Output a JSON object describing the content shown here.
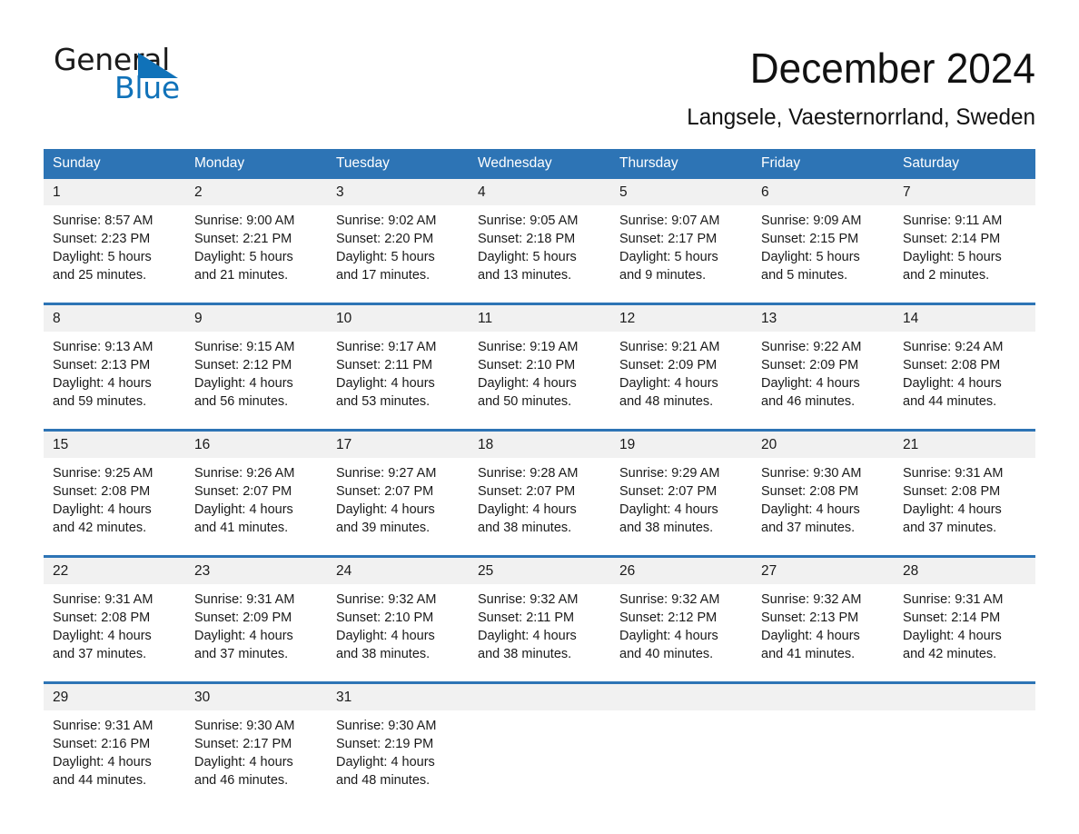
{
  "brand": {
    "name_dark": "General",
    "name_light": "Blue",
    "triangle_color": "#1072b9"
  },
  "header": {
    "month_title": "December 2024",
    "location": "Langsele, Vaesternorrland, Sweden"
  },
  "theme": {
    "header_blue": "#2d74b5",
    "daynum_band": "#f1f1f1",
    "text": "#1a1a1a"
  },
  "calendar": {
    "weekday_headers": [
      "Sunday",
      "Monday",
      "Tuesday",
      "Wednesday",
      "Thursday",
      "Friday",
      "Saturday"
    ],
    "weeks": [
      [
        {
          "day": "1",
          "sunrise": "Sunrise: 8:57 AM",
          "sunset": "Sunset: 2:23 PM",
          "daylight1": "Daylight: 5 hours",
          "daylight2": "and 25 minutes."
        },
        {
          "day": "2",
          "sunrise": "Sunrise: 9:00 AM",
          "sunset": "Sunset: 2:21 PM",
          "daylight1": "Daylight: 5 hours",
          "daylight2": "and 21 minutes."
        },
        {
          "day": "3",
          "sunrise": "Sunrise: 9:02 AM",
          "sunset": "Sunset: 2:20 PM",
          "daylight1": "Daylight: 5 hours",
          "daylight2": "and 17 minutes."
        },
        {
          "day": "4",
          "sunrise": "Sunrise: 9:05 AM",
          "sunset": "Sunset: 2:18 PM",
          "daylight1": "Daylight: 5 hours",
          "daylight2": "and 13 minutes."
        },
        {
          "day": "5",
          "sunrise": "Sunrise: 9:07 AM",
          "sunset": "Sunset: 2:17 PM",
          "daylight1": "Daylight: 5 hours",
          "daylight2": "and 9 minutes."
        },
        {
          "day": "6",
          "sunrise": "Sunrise: 9:09 AM",
          "sunset": "Sunset: 2:15 PM",
          "daylight1": "Daylight: 5 hours",
          "daylight2": "and 5 minutes."
        },
        {
          "day": "7",
          "sunrise": "Sunrise: 9:11 AM",
          "sunset": "Sunset: 2:14 PM",
          "daylight1": "Daylight: 5 hours",
          "daylight2": "and 2 minutes."
        }
      ],
      [
        {
          "day": "8",
          "sunrise": "Sunrise: 9:13 AM",
          "sunset": "Sunset: 2:13 PM",
          "daylight1": "Daylight: 4 hours",
          "daylight2": "and 59 minutes."
        },
        {
          "day": "9",
          "sunrise": "Sunrise: 9:15 AM",
          "sunset": "Sunset: 2:12 PM",
          "daylight1": "Daylight: 4 hours",
          "daylight2": "and 56 minutes."
        },
        {
          "day": "10",
          "sunrise": "Sunrise: 9:17 AM",
          "sunset": "Sunset: 2:11 PM",
          "daylight1": "Daylight: 4 hours",
          "daylight2": "and 53 minutes."
        },
        {
          "day": "11",
          "sunrise": "Sunrise: 9:19 AM",
          "sunset": "Sunset: 2:10 PM",
          "daylight1": "Daylight: 4 hours",
          "daylight2": "and 50 minutes."
        },
        {
          "day": "12",
          "sunrise": "Sunrise: 9:21 AM",
          "sunset": "Sunset: 2:09 PM",
          "daylight1": "Daylight: 4 hours",
          "daylight2": "and 48 minutes."
        },
        {
          "day": "13",
          "sunrise": "Sunrise: 9:22 AM",
          "sunset": "Sunset: 2:09 PM",
          "daylight1": "Daylight: 4 hours",
          "daylight2": "and 46 minutes."
        },
        {
          "day": "14",
          "sunrise": "Sunrise: 9:24 AM",
          "sunset": "Sunset: 2:08 PM",
          "daylight1": "Daylight: 4 hours",
          "daylight2": "and 44 minutes."
        }
      ],
      [
        {
          "day": "15",
          "sunrise": "Sunrise: 9:25 AM",
          "sunset": "Sunset: 2:08 PM",
          "daylight1": "Daylight: 4 hours",
          "daylight2": "and 42 minutes."
        },
        {
          "day": "16",
          "sunrise": "Sunrise: 9:26 AM",
          "sunset": "Sunset: 2:07 PM",
          "daylight1": "Daylight: 4 hours",
          "daylight2": "and 41 minutes."
        },
        {
          "day": "17",
          "sunrise": "Sunrise: 9:27 AM",
          "sunset": "Sunset: 2:07 PM",
          "daylight1": "Daylight: 4 hours",
          "daylight2": "and 39 minutes."
        },
        {
          "day": "18",
          "sunrise": "Sunrise: 9:28 AM",
          "sunset": "Sunset: 2:07 PM",
          "daylight1": "Daylight: 4 hours",
          "daylight2": "and 38 minutes."
        },
        {
          "day": "19",
          "sunrise": "Sunrise: 9:29 AM",
          "sunset": "Sunset: 2:07 PM",
          "daylight1": "Daylight: 4 hours",
          "daylight2": "and 38 minutes."
        },
        {
          "day": "20",
          "sunrise": "Sunrise: 9:30 AM",
          "sunset": "Sunset: 2:08 PM",
          "daylight1": "Daylight: 4 hours",
          "daylight2": "and 37 minutes."
        },
        {
          "day": "21",
          "sunrise": "Sunrise: 9:31 AM",
          "sunset": "Sunset: 2:08 PM",
          "daylight1": "Daylight: 4 hours",
          "daylight2": "and 37 minutes."
        }
      ],
      [
        {
          "day": "22",
          "sunrise": "Sunrise: 9:31 AM",
          "sunset": "Sunset: 2:08 PM",
          "daylight1": "Daylight: 4 hours",
          "daylight2": "and 37 minutes."
        },
        {
          "day": "23",
          "sunrise": "Sunrise: 9:31 AM",
          "sunset": "Sunset: 2:09 PM",
          "daylight1": "Daylight: 4 hours",
          "daylight2": "and 37 minutes."
        },
        {
          "day": "24",
          "sunrise": "Sunrise: 9:32 AM",
          "sunset": "Sunset: 2:10 PM",
          "daylight1": "Daylight: 4 hours",
          "daylight2": "and 38 minutes."
        },
        {
          "day": "25",
          "sunrise": "Sunrise: 9:32 AM",
          "sunset": "Sunset: 2:11 PM",
          "daylight1": "Daylight: 4 hours",
          "daylight2": "and 38 minutes."
        },
        {
          "day": "26",
          "sunrise": "Sunrise: 9:32 AM",
          "sunset": "Sunset: 2:12 PM",
          "daylight1": "Daylight: 4 hours",
          "daylight2": "and 40 minutes."
        },
        {
          "day": "27",
          "sunrise": "Sunrise: 9:32 AM",
          "sunset": "Sunset: 2:13 PM",
          "daylight1": "Daylight: 4 hours",
          "daylight2": "and 41 minutes."
        },
        {
          "day": "28",
          "sunrise": "Sunrise: 9:31 AM",
          "sunset": "Sunset: 2:14 PM",
          "daylight1": "Daylight: 4 hours",
          "daylight2": "and 42 minutes."
        }
      ],
      [
        {
          "day": "29",
          "sunrise": "Sunrise: 9:31 AM",
          "sunset": "Sunset: 2:16 PM",
          "daylight1": "Daylight: 4 hours",
          "daylight2": "and 44 minutes."
        },
        {
          "day": "30",
          "sunrise": "Sunrise: 9:30 AM",
          "sunset": "Sunset: 2:17 PM",
          "daylight1": "Daylight: 4 hours",
          "daylight2": "and 46 minutes."
        },
        {
          "day": "31",
          "sunrise": "Sunrise: 9:30 AM",
          "sunset": "Sunset: 2:19 PM",
          "daylight1": "Daylight: 4 hours",
          "daylight2": "and 48 minutes."
        },
        {
          "day": "",
          "sunrise": "",
          "sunset": "",
          "daylight1": "",
          "daylight2": ""
        },
        {
          "day": "",
          "sunrise": "",
          "sunset": "",
          "daylight1": "",
          "daylight2": ""
        },
        {
          "day": "",
          "sunrise": "",
          "sunset": "",
          "daylight1": "",
          "daylight2": ""
        },
        {
          "day": "",
          "sunrise": "",
          "sunset": "",
          "daylight1": "",
          "daylight2": ""
        }
      ]
    ]
  }
}
